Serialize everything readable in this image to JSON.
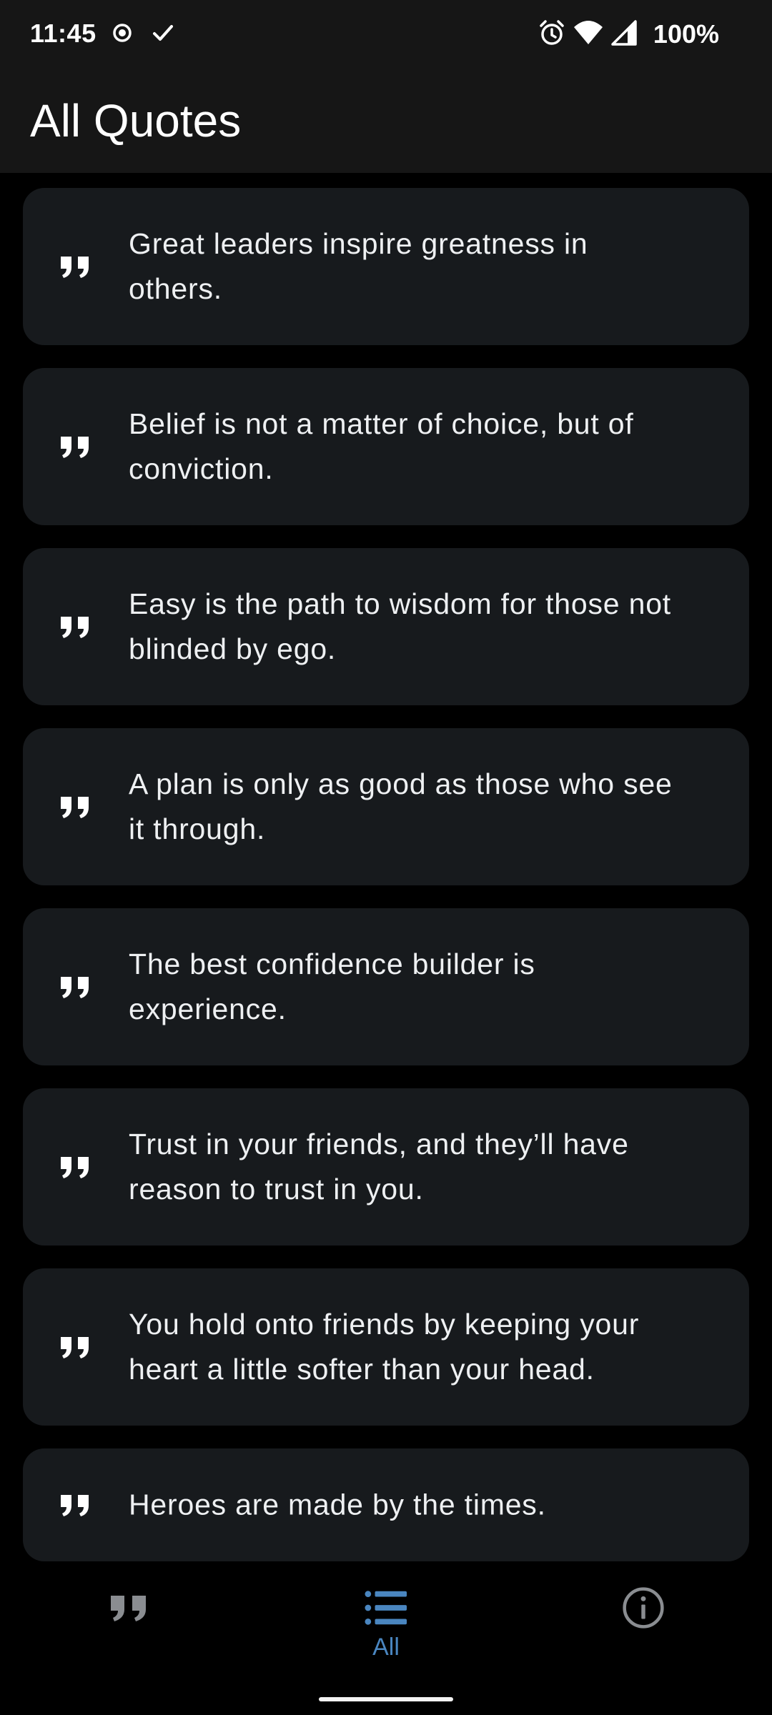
{
  "status_bar": {
    "time": "11:45",
    "battery": "100%",
    "left_icons": [
      "record-icon",
      "check-icon"
    ],
    "right_icons": [
      "alarm-icon",
      "wifi-icon",
      "signal-icon"
    ]
  },
  "app_bar": {
    "title": "All Quotes"
  },
  "quotes": [
    {
      "line1": "Great leaders inspire greatness in",
      "line2": "others."
    },
    {
      "line1": "Belief is not a matter of choice, but of",
      "line2": "conviction."
    },
    {
      "line1": "Easy is the path to wisdom for those not",
      "line2": "blinded by ego."
    },
    {
      "line1": "A plan is only as good as those who see",
      "line2": "it through."
    },
    {
      "line1": "The best confidence builder is",
      "line2": "experience."
    },
    {
      "line1": "Trust in your friends, and they’ll have",
      "line2": "reason to trust in you."
    },
    {
      "line1": "You hold onto friends by keeping your",
      "line2": "heart a little softer than your head."
    },
    {
      "line1": "Heroes are made by the times.",
      "line2": ""
    }
  ],
  "bottom_nav": {
    "items": [
      {
        "icon": "quote-icon",
        "label": "",
        "active": false
      },
      {
        "icon": "list-icon",
        "label": "All",
        "active": true
      },
      {
        "icon": "info-icon",
        "label": "",
        "active": false
      }
    ]
  },
  "colors": {
    "background": "#000000",
    "bar": "#161616",
    "card": "#171a1d",
    "accent": "#4a86c0",
    "inactive_icon": "#8a8d91"
  }
}
